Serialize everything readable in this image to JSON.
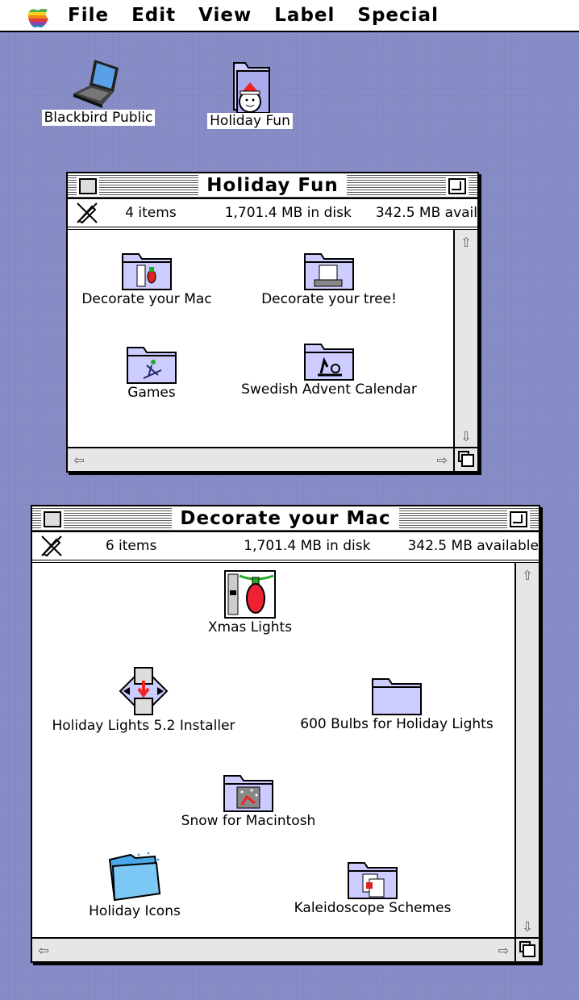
{
  "menubar": {
    "apple_icon": "apple-rainbow-icon",
    "items": [
      "File",
      "Edit",
      "View",
      "Label",
      "Special"
    ]
  },
  "desktop": {
    "icons": [
      {
        "label": "Blackbird Public",
        "icon": "powerbook-icon"
      },
      {
        "label": "Holiday Fun",
        "icon": "snowman-folder-icon"
      }
    ]
  },
  "window_holiday_fun": {
    "title": "Holiday Fun",
    "items_count": "4 items",
    "in_disk": "1,701.4 MB in disk",
    "available": "342.5 MB avail",
    "items": [
      {
        "label": "Decorate your Mac",
        "icon": "folder-icon"
      },
      {
        "label": "Decorate your tree!",
        "icon": "folder-icon"
      },
      {
        "label": "Games",
        "icon": "folder-icon"
      },
      {
        "label": "Swedish Advent Calendar",
        "icon": "folder-icon"
      }
    ]
  },
  "window_decorate_mac": {
    "title": "Decorate your Mac",
    "items_count": "6 items",
    "in_disk": "1,701.4 MB in disk",
    "available": "342.5 MB available",
    "items": [
      {
        "label": "Xmas Lights",
        "icon": "xmas-lights-icon"
      },
      {
        "label": "Holiday Lights 5.2 Installer",
        "icon": "installer-icon"
      },
      {
        "label": "600 Bulbs for Holiday Lights",
        "icon": "folder-icon"
      },
      {
        "label": "Snow for Macintosh",
        "icon": "folder-icon"
      },
      {
        "label": "Holiday Icons",
        "icon": "blue-folder-icon"
      },
      {
        "label": "Kaleidoscope Schemes",
        "icon": "folder-icon"
      }
    ]
  },
  "colors": {
    "desktop": "#8a8fc8",
    "folder": "#ccccff"
  }
}
